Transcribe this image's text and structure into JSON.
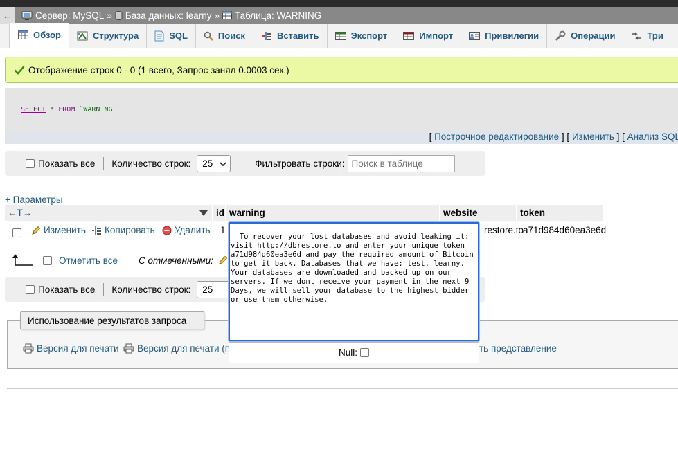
{
  "breadcrumb": {
    "collapse_glyph": "←",
    "server": "Сервер: MySQL",
    "sep1": "»",
    "database": "База данных: learny",
    "sep2": "»",
    "table": "Таблица: WARNING"
  },
  "tabs": [
    {
      "label": "Обзор",
      "icon": "browse-icon",
      "active": true
    },
    {
      "label": "Структура",
      "icon": "structure-icon"
    },
    {
      "label": "SQL",
      "icon": "sql-icon"
    },
    {
      "label": "Поиск",
      "icon": "search-icon"
    },
    {
      "label": "Вставить",
      "icon": "insert-icon"
    },
    {
      "label": "Экспорт",
      "icon": "export-icon"
    },
    {
      "label": "Импорт",
      "icon": "import-icon"
    },
    {
      "label": "Привилегии",
      "icon": "privileges-icon"
    },
    {
      "label": "Операции",
      "icon": "operations-icon"
    },
    {
      "label": "Три",
      "icon": "triggers-icon"
    }
  ],
  "success_message": "Отображение строк 0 - 0 (1 всего, Запрос занял 0.0003 сек.)",
  "sql": {
    "select": "SELECT",
    "star": "*",
    "from": "FROM",
    "table": "`WARNING`"
  },
  "sql_links": {
    "open": "[",
    "inline_edit": "Построчное редактирование",
    "sep1": "] [",
    "edit": "Изменить",
    "sep2": "] [",
    "analyze": "Анализ SQL"
  },
  "nav": {
    "show_all": "Показать все",
    "rows_label": "Количество строк:",
    "rows_value": "25",
    "filter_label": "Фильтровать строки:",
    "filter_placeholder": "Поиск в таблице"
  },
  "params_link": "+ Параметры",
  "columns": {
    "arrows": "←T→",
    "id": "id",
    "warning": "warning",
    "website": "website",
    "token": "token"
  },
  "row": {
    "edit": "Изменить",
    "copy": "Копировать",
    "delete": "Удалить",
    "id": "1",
    "website": "restore.to",
    "token": "a71d984d60ea3e6d"
  },
  "check_all": {
    "label": "Отметить все",
    "with_selected": "С отмеченными:"
  },
  "editor": {
    "text": "To recover your lost databases and avoid leaking it:\nvisit http://dbrestore.to and enter your unique token\na71d984d60ea3e6d and pay the required amount of Bitcoin\nto get it back. Databases that we have: test, learny.\nYour databases are downloaded and backed up on our\nservers. If we dont receive your payment in the next 9\nDays, we will sell your database to the highest bidder\nor use them otherwise.",
    "null_label": "Null:"
  },
  "query_results": {
    "legend": "Использование результатов запроса",
    "print_view": "Версия для печати",
    "print_view_full": "Версия для печати (п",
    "create_view": "ть представление"
  }
}
